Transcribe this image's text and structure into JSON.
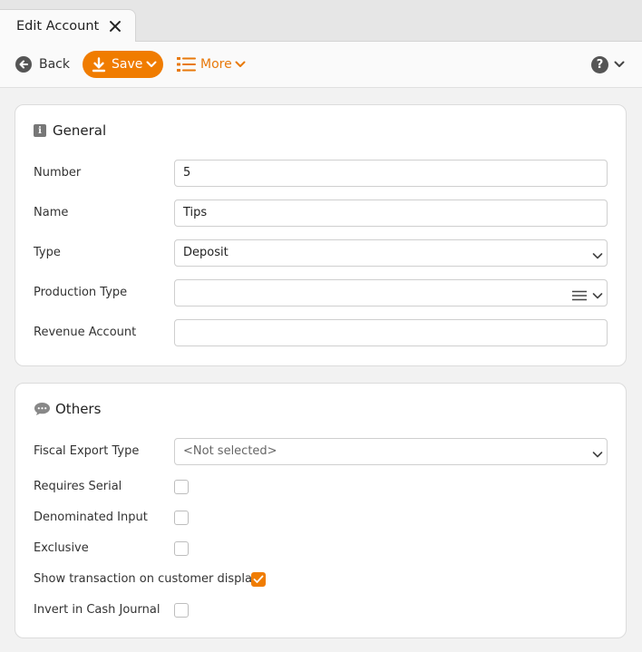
{
  "tab": {
    "title": "Edit Account"
  },
  "toolbar": {
    "back_label": "Back",
    "save_label": "Save",
    "more_label": "More",
    "help_glyph": "?"
  },
  "general": {
    "title": "General",
    "fields": {
      "number": {
        "label": "Number",
        "value": "5"
      },
      "name": {
        "label": "Name",
        "value": "Tips"
      },
      "type": {
        "label": "Type",
        "value": "Deposit"
      },
      "production_type": {
        "label": "Production Type",
        "value": ""
      },
      "revenue_account": {
        "label": "Revenue Account",
        "value": ""
      }
    }
  },
  "others": {
    "title": "Others",
    "fiscal_export_type": {
      "label": "Fiscal Export Type",
      "value": "<Not selected>"
    },
    "requires_serial": {
      "label": "Requires Serial",
      "checked": false
    },
    "denominated_input": {
      "label": "Denominated Input",
      "checked": false
    },
    "exclusive": {
      "label": "Exclusive",
      "checked": false
    },
    "show_on_customer_display": {
      "label": "Show transaction on customer display",
      "checked": true
    },
    "invert_in_cash_journal": {
      "label": "Invert in Cash Journal",
      "checked": false
    }
  },
  "colors": {
    "accent": "#f07c00",
    "more_text": "#e8790b"
  },
  "icons": {
    "close": "close-icon",
    "back": "arrow-left-icon",
    "save": "download-icon",
    "more": "list-icon",
    "help": "help-icon",
    "info": "info-icon",
    "chat": "chat-bubble-icon",
    "dropdown": "chevron-down-icon"
  }
}
